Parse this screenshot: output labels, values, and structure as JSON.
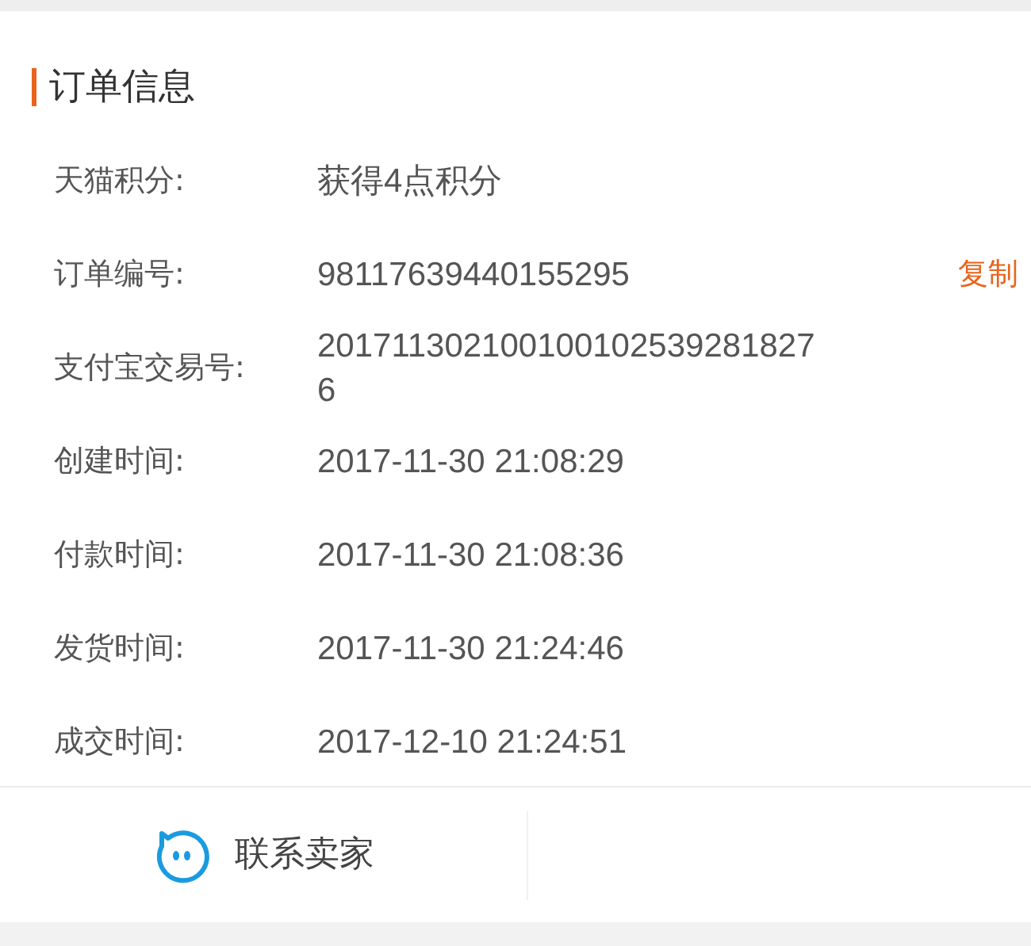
{
  "section_title": "订单信息",
  "rows": [
    {
      "label": "天猫积分:",
      "value": "获得4点积分"
    },
    {
      "label": "订单编号:",
      "value": "98117639440155295",
      "action": "复制"
    },
    {
      "label": "支付宝交易号:",
      "value": "2017113021001001025392818276"
    },
    {
      "label": "创建时间:",
      "value": "2017-11-30 21:08:29"
    },
    {
      "label": "付款时间:",
      "value": "2017-11-30 21:08:36"
    },
    {
      "label": "发货时间:",
      "value": "2017-11-30 21:24:46"
    },
    {
      "label": "成交时间:",
      "value": "2017-12-10 21:24:51"
    }
  ],
  "footer_button": {
    "label": "联系卖家"
  }
}
